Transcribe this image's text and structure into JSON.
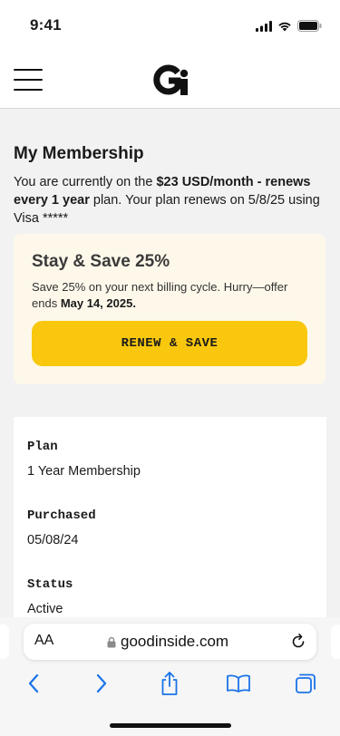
{
  "status_bar": {
    "time": "9:41"
  },
  "header": {
    "logo_alt": "Good Inside"
  },
  "main": {
    "title": "My Membership",
    "intro": {
      "prefix": "You are currently on the ",
      "plan": "$23 USD/month - renews every 1 year",
      "suffix": " plan. Your plan renews on 5/8/25 using Visa *****"
    },
    "offer": {
      "title": "Stay & Save 25%",
      "text": "Save 25% on your next billing cycle. Hurry—offer ends ",
      "deadline": "May 14, 2025.",
      "button_label": "RENEW & SAVE"
    },
    "details": [
      {
        "label": "Plan",
        "value": "1 Year Membership"
      },
      {
        "label": "Purchased",
        "value": "05/08/24"
      },
      {
        "label": "Status",
        "value": "Active"
      }
    ]
  },
  "browser": {
    "text_size_label": "AA",
    "url": "goodinside.com"
  },
  "colors": {
    "accent": "#f9c80e",
    "offer_bg": "#fdf8ea",
    "ios_blue": "#1a73e8"
  }
}
